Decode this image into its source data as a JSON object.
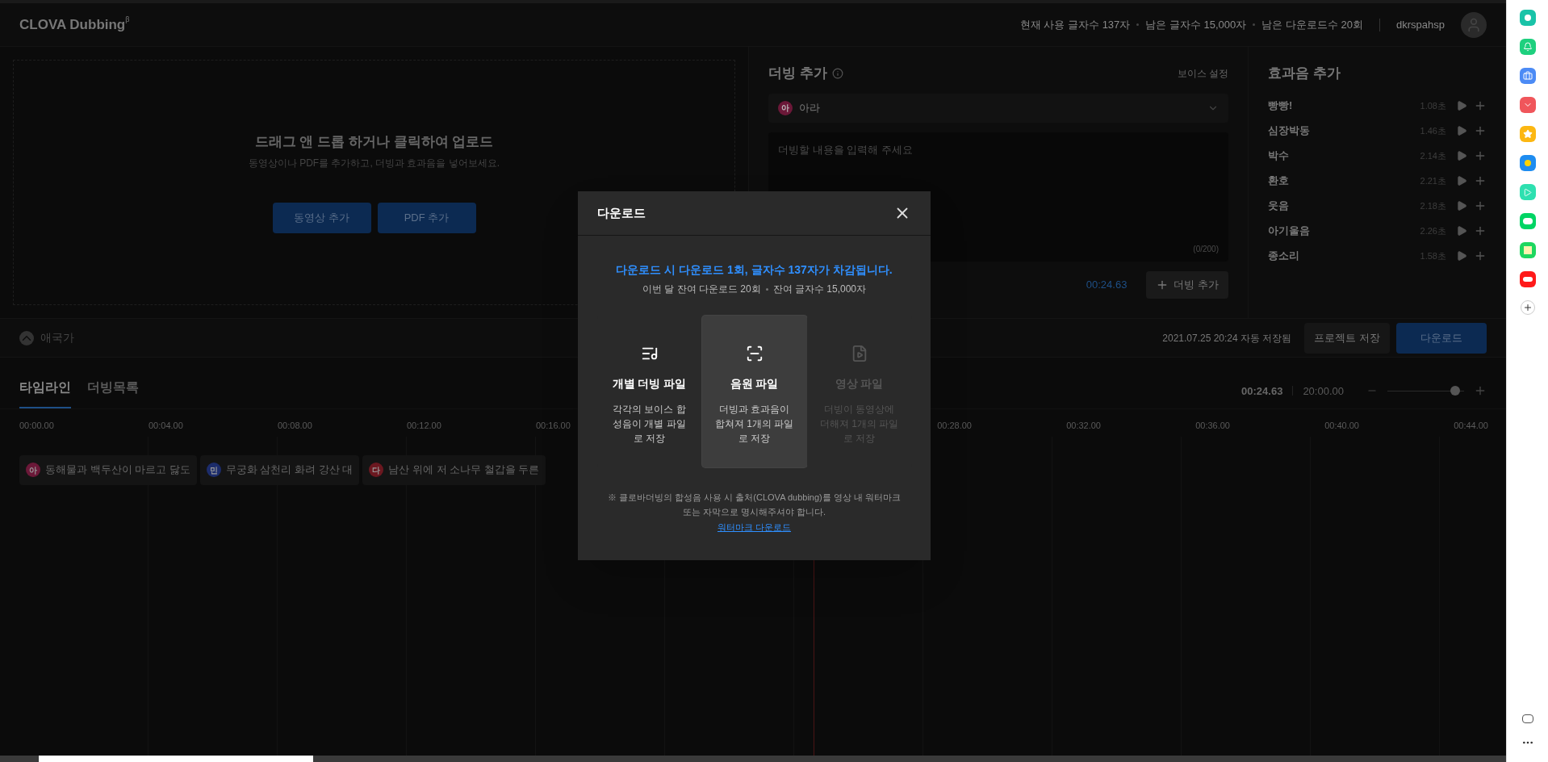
{
  "header": {
    "logo": "CLOVA Dubbing",
    "logo_mark": "β",
    "stats": [
      "현재 사용 글자수 137자",
      "남은 글자수 15,000자",
      "남은 다운로드수 20회"
    ],
    "user": "dkrspahsp"
  },
  "upload": {
    "title": "드래그 앤 드롭 하거나 클릭하여 업로드",
    "subtitle": "동영상이나 PDF를 추가하고, 더빙과 효과음을 넣어보세요.",
    "buttons": [
      "동영상 추가",
      "PDF 추가"
    ]
  },
  "dubbing": {
    "title": "더빙 추가",
    "voice_settings": "보이스 설정",
    "voice": {
      "badge": "아",
      "name": "아라",
      "color": "#6b1838"
    },
    "placeholder": "더빙할 내용을 입력해 주세요",
    "counter": "(0/200)",
    "time": "00:24.63",
    "add_button": "더빙 추가"
  },
  "effects": {
    "title": "효과음 추가",
    "items": [
      {
        "name": "빵빵!",
        "duration": "1.08초"
      },
      {
        "name": "심장박동",
        "duration": "1.46초"
      },
      {
        "name": "박수",
        "duration": "2.14초"
      },
      {
        "name": "환호",
        "duration": "2.21초"
      },
      {
        "name": "웃음",
        "duration": "2.18초"
      },
      {
        "name": "아기울음",
        "duration": "2.26초"
      },
      {
        "name": "종소리",
        "duration": "1.58초"
      }
    ]
  },
  "project": {
    "name": "애국가",
    "saved": "2021.07.25 20:24 자동 저장됨",
    "save_button": "프로젝트 저장",
    "download_button": "다운로드"
  },
  "timeline": {
    "tabs": [
      {
        "label": "타임라인",
        "selected": true
      },
      {
        "label": "더빙목록",
        "selected": false
      }
    ],
    "current": "00:24.63",
    "total": "20:00.00",
    "zoom": {
      "level": 0.88
    },
    "left_ticks": [
      "00:00.00",
      "00:04.00",
      "00:08.00",
      "00:12.00",
      "00:16.00"
    ],
    "right_ticks": [
      "00:28.00",
      "00:32.00",
      "00:36.00",
      "00:40.00",
      "00:44.00"
    ],
    "clips": [
      {
        "badge": "아",
        "color": "#6b1838",
        "text": "동해물과 백두산이 마르고 닳도"
      },
      {
        "badge": "민",
        "color": "#1c2c6b",
        "text": "무궁화 삼천리 화려 강산 대"
      },
      {
        "badge": "다",
        "color": "#6b1820",
        "text": "남산 위에 저 소나무 철갑을 두른"
      }
    ]
  },
  "modal": {
    "title": "다운로드",
    "notice": "다운로드 시 다운로드 1회, 글자수 137자가 차감됩니다.",
    "remaining": [
      "이번 달 잔여 다운로드 20회",
      "잔여 글자수 15,000자"
    ],
    "options": [
      {
        "kind": "dubbing",
        "title": "개별 더빙 파일",
        "description": "각각의 보이스 합성음이 개별 파일로 저장",
        "selected": false,
        "disabled": false
      },
      {
        "kind": "audio",
        "title": "음원 파일",
        "description": "더빙과 효과음이 합쳐져 1개의 파일로 저장",
        "selected": true,
        "disabled": false
      },
      {
        "kind": "video",
        "title": "영상 파일",
        "description": "더빙이 동영상에 더해져 1개의 파일로 저장",
        "selected": false,
        "disabled": true
      }
    ],
    "footnote": "※ 클로바더빙의 합성음 사용 시 출처(CLOVA dubbing)를 영상 내 워터마크 또는 자막으로 명시해주셔야 합니다.",
    "link": "워터마크 다운로드"
  }
}
